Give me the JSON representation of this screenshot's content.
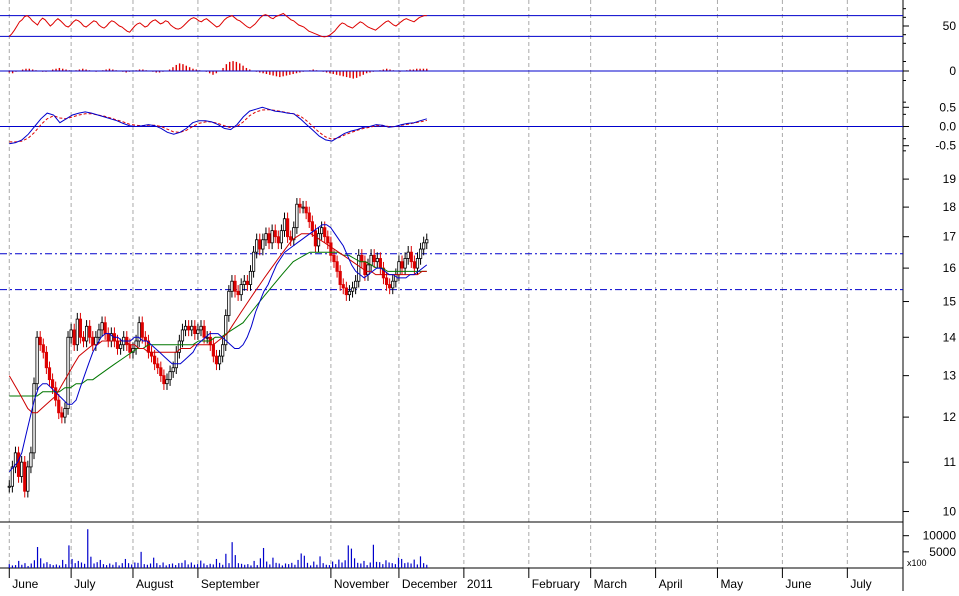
{
  "chart_data": {
    "type": "candlestick",
    "colors": {
      "up": "#000000",
      "down": "#dd0000",
      "ma_short": "#0000cc",
      "ma_mid": "#cc0000",
      "ma_long": "#007700",
      "rsi": "#dd0000",
      "macd": "#0000cc",
      "signal": "#dd0000",
      "hist": "#dd0000",
      "volume": "#0000cc",
      "frame": "#000000",
      "grid": "#aaaaaa",
      "hline": "#0000cc"
    },
    "x_axis": {
      "months": [
        {
          "label": "June",
          "x": 0
        },
        {
          "label": "July",
          "x": 20
        },
        {
          "label": "August",
          "x": 40
        },
        {
          "label": "September",
          "x": 61
        },
        {
          "label": "November",
          "x": 104
        },
        {
          "label": "December",
          "x": 126
        },
        {
          "label": "2011",
          "x": 147
        },
        {
          "label": "February",
          "x": 168
        },
        {
          "label": "March",
          "x": 188
        },
        {
          "label": "April",
          "x": 209
        },
        {
          "label": "May",
          "x": 229
        },
        {
          "label": "June",
          "x": 250
        },
        {
          "label": "July",
          "x": 271
        }
      ],
      "range": [
        -3,
        289
      ]
    },
    "rsi_panel": {
      "ticks": [
        "50"
      ],
      "tick_values": [
        50
      ],
      "levels": [
        70,
        30
      ],
      "ylim": [
        0,
        100
      ],
      "values": [
        30,
        35,
        42,
        50,
        58,
        62,
        68,
        70,
        66,
        60,
        56,
        52,
        60,
        65,
        62,
        56,
        50,
        54,
        60,
        64,
        60,
        55,
        50,
        48,
        52,
        58,
        62,
        60,
        56,
        50,
        48,
        52,
        56,
        60,
        58,
        52,
        48,
        46,
        50,
        56,
        60,
        58,
        54,
        50,
        48,
        44,
        40,
        38,
        44,
        50,
        54,
        56,
        52,
        48,
        50,
        56,
        60,
        62,
        58,
        54,
        56,
        60,
        58,
        52,
        48,
        45,
        44,
        46,
        50,
        55,
        60,
        64,
        66,
        64,
        60,
        58,
        62,
        64,
        60,
        56,
        52,
        48,
        50,
        56,
        62,
        66,
        68,
        70,
        66,
        62,
        60,
        56,
        52,
        48,
        46,
        50,
        54,
        60,
        66,
        70,
        72,
        70,
        66,
        64,
        68,
        70,
        72,
        74,
        70,
        66,
        62,
        60,
        56,
        52,
        50,
        48,
        44,
        40,
        38,
        36,
        34,
        32,
        30,
        29,
        30,
        32,
        36,
        40,
        46,
        52,
        56,
        54,
        50,
        48,
        46,
        50,
        54,
        58,
        56,
        52,
        48,
        46,
        44,
        42,
        46,
        50,
        54,
        58,
        60,
        56,
        52,
        50,
        54,
        58,
        62,
        64,
        62,
        60,
        58,
        62,
        66,
        68,
        70,
        70
      ]
    },
    "macd_hist_panel": {
      "ticks": [
        "0"
      ],
      "tick_values": [
        0
      ],
      "ylim": [
        -0.25,
        0.25
      ],
      "values": [
        -0.02,
        -0.03,
        -0.01,
        0.0,
        0.02,
        0.03,
        0.03,
        0.02,
        0.01,
        0.0,
        -0.01,
        -0.01,
        0.0,
        0.02,
        0.03,
        0.04,
        0.03,
        0.02,
        0.01,
        0.0,
        0.01,
        0.02,
        0.03,
        0.02,
        0.01,
        0.0,
        -0.01,
        0.0,
        0.01,
        0.02,
        0.03,
        0.02,
        0.01,
        0.0,
        -0.01,
        -0.02,
        -0.01,
        0.0,
        0.01,
        0.02,
        0.02,
        0.01,
        0.0,
        -0.01,
        -0.02,
        -0.02,
        -0.01,
        0.0,
        0.02,
        0.05,
        0.08,
        0.1,
        0.09,
        0.07,
        0.05,
        0.03,
        0.02,
        0.01,
        0.0,
        -0.01,
        -0.03,
        -0.05,
        -0.03,
        0.0,
        0.04,
        0.09,
        0.12,
        0.13,
        0.12,
        0.1,
        0.07,
        0.04,
        0.02,
        0.0,
        -0.01,
        -0.02,
        -0.03,
        -0.04,
        -0.05,
        -0.06,
        -0.07,
        -0.08,
        -0.07,
        -0.06,
        -0.05,
        -0.04,
        -0.03,
        -0.02,
        -0.01,
        0.0,
        0.01,
        0.02,
        0.01,
        0.0,
        -0.01,
        -0.02,
        -0.03,
        -0.04,
        -0.05,
        -0.06,
        -0.07,
        -0.08,
        -0.09,
        -0.1,
        -0.09,
        -0.07,
        -0.05,
        -0.03,
        -0.02,
        -0.01,
        0.0,
        0.01,
        0.02,
        0.03,
        0.02,
        0.01,
        0.0,
        -0.01,
        0.0,
        0.01,
        0.02,
        0.02,
        0.03,
        0.03,
        0.03,
        0.03
      ]
    },
    "macd_panel": {
      "ticks": [
        "0.5",
        "0.0",
        "-0.5"
      ],
      "tick_values": [
        0.5,
        0.0,
        -0.5
      ],
      "levels": [
        0
      ],
      "ylim": [
        -0.95,
        0.95
      ],
      "macd": [
        -0.45,
        -0.42,
        -0.35,
        -0.2,
        0.0,
        0.2,
        0.35,
        0.3,
        0.1,
        0.2,
        0.3,
        0.35,
        0.38,
        0.35,
        0.3,
        0.25,
        0.2,
        0.15,
        0.08,
        0.02,
        0.0,
        0.02,
        0.05,
        0.02,
        -0.05,
        -0.15,
        -0.2,
        -0.15,
        -0.05,
        0.1,
        0.15,
        0.15,
        0.12,
        0.05,
        -0.05,
        -0.08,
        0.05,
        0.25,
        0.4,
        0.45,
        0.5,
        0.45,
        0.4,
        0.38,
        0.35,
        0.33,
        0.2,
        0.05,
        -0.1,
        -0.25,
        -0.35,
        -0.38,
        -0.28,
        -0.18,
        -0.12,
        -0.08,
        -0.02,
        0.0,
        0.05,
        0.03,
        -0.02,
        0.0,
        0.05,
        0.08,
        0.1,
        0.15,
        0.2
      ],
      "signal": [
        -0.4,
        -0.4,
        -0.38,
        -0.3,
        -0.15,
        0.05,
        0.2,
        0.28,
        0.22,
        0.2,
        0.25,
        0.3,
        0.33,
        0.33,
        0.3,
        0.27,
        0.22,
        0.17,
        0.12,
        0.06,
        0.03,
        0.02,
        0.03,
        0.03,
        0.0,
        -0.07,
        -0.14,
        -0.15,
        -0.1,
        0.0,
        0.08,
        0.12,
        0.12,
        0.08,
        0.02,
        -0.03,
        0.0,
        0.12,
        0.28,
        0.38,
        0.43,
        0.44,
        0.42,
        0.39,
        0.36,
        0.33,
        0.27,
        0.15,
        0.0,
        -0.15,
        -0.27,
        -0.33,
        -0.3,
        -0.22,
        -0.16,
        -0.1,
        -0.05,
        -0.02,
        0.02,
        0.02,
        0.0,
        0.0,
        0.03,
        0.06,
        0.09,
        0.12,
        0.16
      ]
    },
    "price_panel": {
      "scale": "log",
      "ylim": [
        9.8,
        19.6
      ],
      "ticks": [
        "19",
        "18",
        "17",
        "16",
        "15",
        "14",
        "13",
        "12",
        "11",
        "10"
      ],
      "tick_values": [
        19,
        18,
        17,
        16,
        15,
        14,
        13,
        12,
        11,
        10
      ],
      "levels": [
        16.45,
        15.35
      ],
      "close": [
        10.5,
        10.9,
        11.2,
        10.7,
        11.0,
        10.4,
        10.9,
        11.2,
        12.8,
        14.0,
        13.8,
        13.6,
        13.2,
        12.9,
        12.7,
        12.4,
        12.1,
        12.0,
        12.2,
        14.0,
        14.2,
        13.8,
        14.5,
        14.0,
        13.9,
        14.3,
        14.0,
        13.8,
        14.0,
        14.2,
        14.4,
        14.1,
        13.9,
        14.1,
        13.9,
        13.7,
        13.8,
        14.0,
        13.8,
        13.6,
        13.7,
        13.9,
        14.4,
        14.0,
        13.9,
        13.6,
        13.5,
        13.3,
        13.2,
        13.0,
        12.8,
        12.9,
        13.1,
        13.2,
        13.6,
        13.9,
        14.2,
        14.3,
        14.2,
        14.3,
        14.1,
        14.2,
        14.3,
        14.0,
        14.0,
        13.8,
        13.5,
        13.3,
        13.5,
        13.8,
        14.6,
        15.3,
        15.6,
        15.3,
        15.2,
        15.5,
        15.6,
        15.5,
        15.9,
        16.5,
        16.9,
        16.6,
        16.9,
        17.1,
        16.8,
        17.2,
        17.0,
        16.8,
        17.2,
        17.6,
        17.0,
        16.9,
        17.3,
        18.1,
        18.0,
        18.0,
        17.8,
        17.5,
        17.2,
        16.7,
        17.1,
        17.3,
        17.0,
        16.8,
        16.4,
        16.2,
        15.9,
        15.5,
        15.4,
        15.2,
        15.3,
        15.4,
        15.6,
        16.4,
        16.2,
        15.8,
        16.1,
        16.4,
        16.2,
        16.3,
        16.0,
        15.7,
        15.5,
        15.4,
        15.6,
        15.8,
        16.2,
        16.0,
        16.3,
        16.5,
        16.2,
        16.0,
        16.3,
        16.6,
        16.8,
        16.9
      ],
      "ma_short": [
        10.8,
        10.9,
        11.0,
        11.2,
        11.6,
        12.0,
        12.4,
        12.7,
        12.8,
        12.8,
        12.7,
        12.6,
        12.5,
        12.4,
        12.3,
        12.3,
        12.4,
        12.7,
        13.0,
        13.3,
        13.6,
        13.8,
        14.0,
        14.1,
        14.1,
        14.0,
        14.0,
        13.9,
        13.9,
        13.9,
        14.0,
        14.0,
        13.9,
        13.9,
        13.8,
        13.7,
        13.6,
        13.5,
        13.4,
        13.3,
        13.3,
        13.3,
        13.4,
        13.5,
        13.6,
        13.8,
        13.9,
        14.0,
        14.1,
        14.1,
        14.1,
        14.0,
        13.9,
        13.8,
        13.7,
        13.7,
        13.8,
        14.0,
        14.3,
        14.7,
        15.0,
        15.3,
        15.5,
        15.8,
        16.1,
        16.3,
        16.5,
        16.6,
        16.7,
        16.8,
        16.9,
        17.0,
        17.1,
        17.2,
        17.3,
        17.4,
        17.4,
        17.3,
        17.1,
        16.9,
        16.7,
        16.4,
        16.1,
        15.9,
        15.8,
        15.7,
        15.8,
        15.9,
        16.0,
        16.0,
        15.9,
        15.8,
        15.8,
        15.7,
        15.7,
        15.7,
        15.8,
        15.8,
        15.9,
        16.0,
        16.1
      ],
      "ma_mid": [
        13.0,
        12.8,
        12.6,
        12.4,
        12.2,
        12.1,
        12.1,
        12.2,
        12.3,
        12.4,
        12.5,
        12.7,
        12.9,
        13.1,
        13.3,
        13.5,
        13.6,
        13.7,
        13.8,
        13.8,
        13.9,
        13.9,
        13.9,
        13.9,
        13.9,
        13.9,
        13.8,
        13.8,
        13.7,
        13.7,
        13.6,
        13.6,
        13.6,
        13.6,
        13.6,
        13.6,
        13.6,
        13.7,
        13.7,
        13.7,
        13.8,
        13.8,
        13.8,
        13.8,
        13.8,
        13.9,
        14.0,
        14.1,
        14.3,
        14.5,
        14.7,
        14.9,
        15.1,
        15.3,
        15.5,
        15.7,
        15.9,
        16.1,
        16.3,
        16.5,
        16.7,
        16.9,
        17.0,
        17.1,
        17.1,
        17.1,
        17.0,
        16.9,
        16.8,
        16.7,
        16.6,
        16.5,
        16.4,
        16.3,
        16.2,
        16.1,
        16.0,
        15.9,
        15.9,
        15.8,
        15.8,
        15.8,
        15.8,
        15.8,
        15.8,
        15.8,
        15.8,
        15.8,
        15.8,
        15.9,
        15.9
      ],
      "ma_long": [
        12.5,
        12.5,
        12.5,
        12.5,
        12.5,
        12.5,
        12.6,
        12.6,
        12.6,
        12.6,
        12.7,
        12.7,
        12.8,
        12.8,
        12.9,
        12.9,
        13.0,
        13.1,
        13.2,
        13.3,
        13.4,
        13.5,
        13.6,
        13.7,
        13.7,
        13.8,
        13.8,
        13.8,
        13.8,
        13.8,
        13.8,
        13.8,
        13.8,
        13.8,
        13.9,
        13.9,
        13.9,
        14.0,
        14.0,
        14.1,
        14.2,
        14.3,
        14.4,
        14.6,
        14.8,
        15.0,
        15.2,
        15.4,
        15.6,
        15.8,
        16.0,
        16.2,
        16.3,
        16.4,
        16.5,
        16.5,
        16.5,
        16.5,
        16.5,
        16.5,
        16.4,
        16.4,
        16.3,
        16.2,
        16.2,
        16.1,
        16.0,
        16.0,
        15.9,
        15.9,
        15.9,
        15.9,
        15.9,
        15.9,
        15.9,
        15.9
      ]
    },
    "volume_panel": {
      "ticks": [
        "10000",
        "5000"
      ],
      "tick_values": [
        10000,
        5000
      ],
      "scale_label": "x100",
      "ylim": [
        0,
        13000
      ],
      "values": [
        1200,
        800,
        900,
        2200,
        1000,
        1500,
        600,
        1400,
        2400,
        6500,
        3000,
        1400,
        1800,
        1200,
        900,
        1100,
        800,
        2500,
        1200,
        7000,
        2800,
        1500,
        2200,
        1700,
        1300,
        12000,
        3500,
        1400,
        1800,
        2500,
        1200,
        900,
        1400,
        1000,
        1800,
        800,
        1500,
        2800,
        1500,
        1100,
        1700,
        1600,
        5000,
        1200,
        1000,
        1400,
        3200,
        1500,
        900,
        1700,
        800,
        1200,
        1400,
        900,
        1500,
        1600,
        2400,
        1100,
        1700,
        1000,
        1200,
        2300,
        1400,
        900,
        1300,
        1100,
        2800,
        1600,
        1000,
        4400,
        1500,
        8000,
        4000,
        1500,
        1300,
        1000,
        1200,
        800,
        2200,
        900,
        3000,
        6200,
        2000,
        1100,
        3200,
        1600,
        1400,
        800,
        1400,
        1200,
        1600,
        1000,
        2500,
        4500,
        3800,
        1600,
        800,
        2000,
        1000,
        3600,
        1500,
        1000,
        900,
        2000,
        1200,
        2600,
        1700,
        2400,
        7000,
        6000,
        3000,
        1600,
        1400,
        2200,
        900,
        1700,
        7200,
        1900,
        1800,
        1200,
        2400,
        1700,
        1500,
        1200,
        3200,
        2800,
        1500,
        1700,
        1400,
        2600,
        1100,
        3600,
        1500,
        1000
      ]
    }
  }
}
